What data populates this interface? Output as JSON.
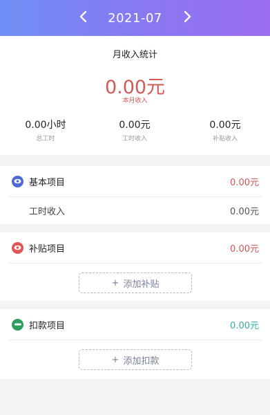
{
  "header": {
    "prev_icon": "chevron-left-icon",
    "next_icon": "chevron-right-icon",
    "month": "2021-07"
  },
  "summary": {
    "title": "月收入统计",
    "total_value": "0.00元",
    "total_label": "本月收入",
    "stats": [
      {
        "value": "0.00小时",
        "label": "总工时"
      },
      {
        "value": "0.00元",
        "label": "工时收入"
      },
      {
        "value": "0.00元",
        "label": "补贴收入"
      }
    ]
  },
  "basic": {
    "title": "基本项目",
    "amount": "0.00元",
    "icon": "eye-icon",
    "color": "#4a6cd4",
    "amount_color": "#d05a55",
    "sub_label": "工时收入",
    "sub_amount": "0.00元"
  },
  "subsidy": {
    "title": "补贴项目",
    "amount": "0.00元",
    "icon": "eye-icon",
    "color": "#e05555",
    "amount_color": "#d05a55",
    "add_label": "添加补贴"
  },
  "deduction": {
    "title": "扣款项目",
    "amount": "0.00元",
    "icon": "minus-icon",
    "color": "#2e9e5e",
    "amount_color": "#3aaea0",
    "add_label": "添加扣款"
  }
}
